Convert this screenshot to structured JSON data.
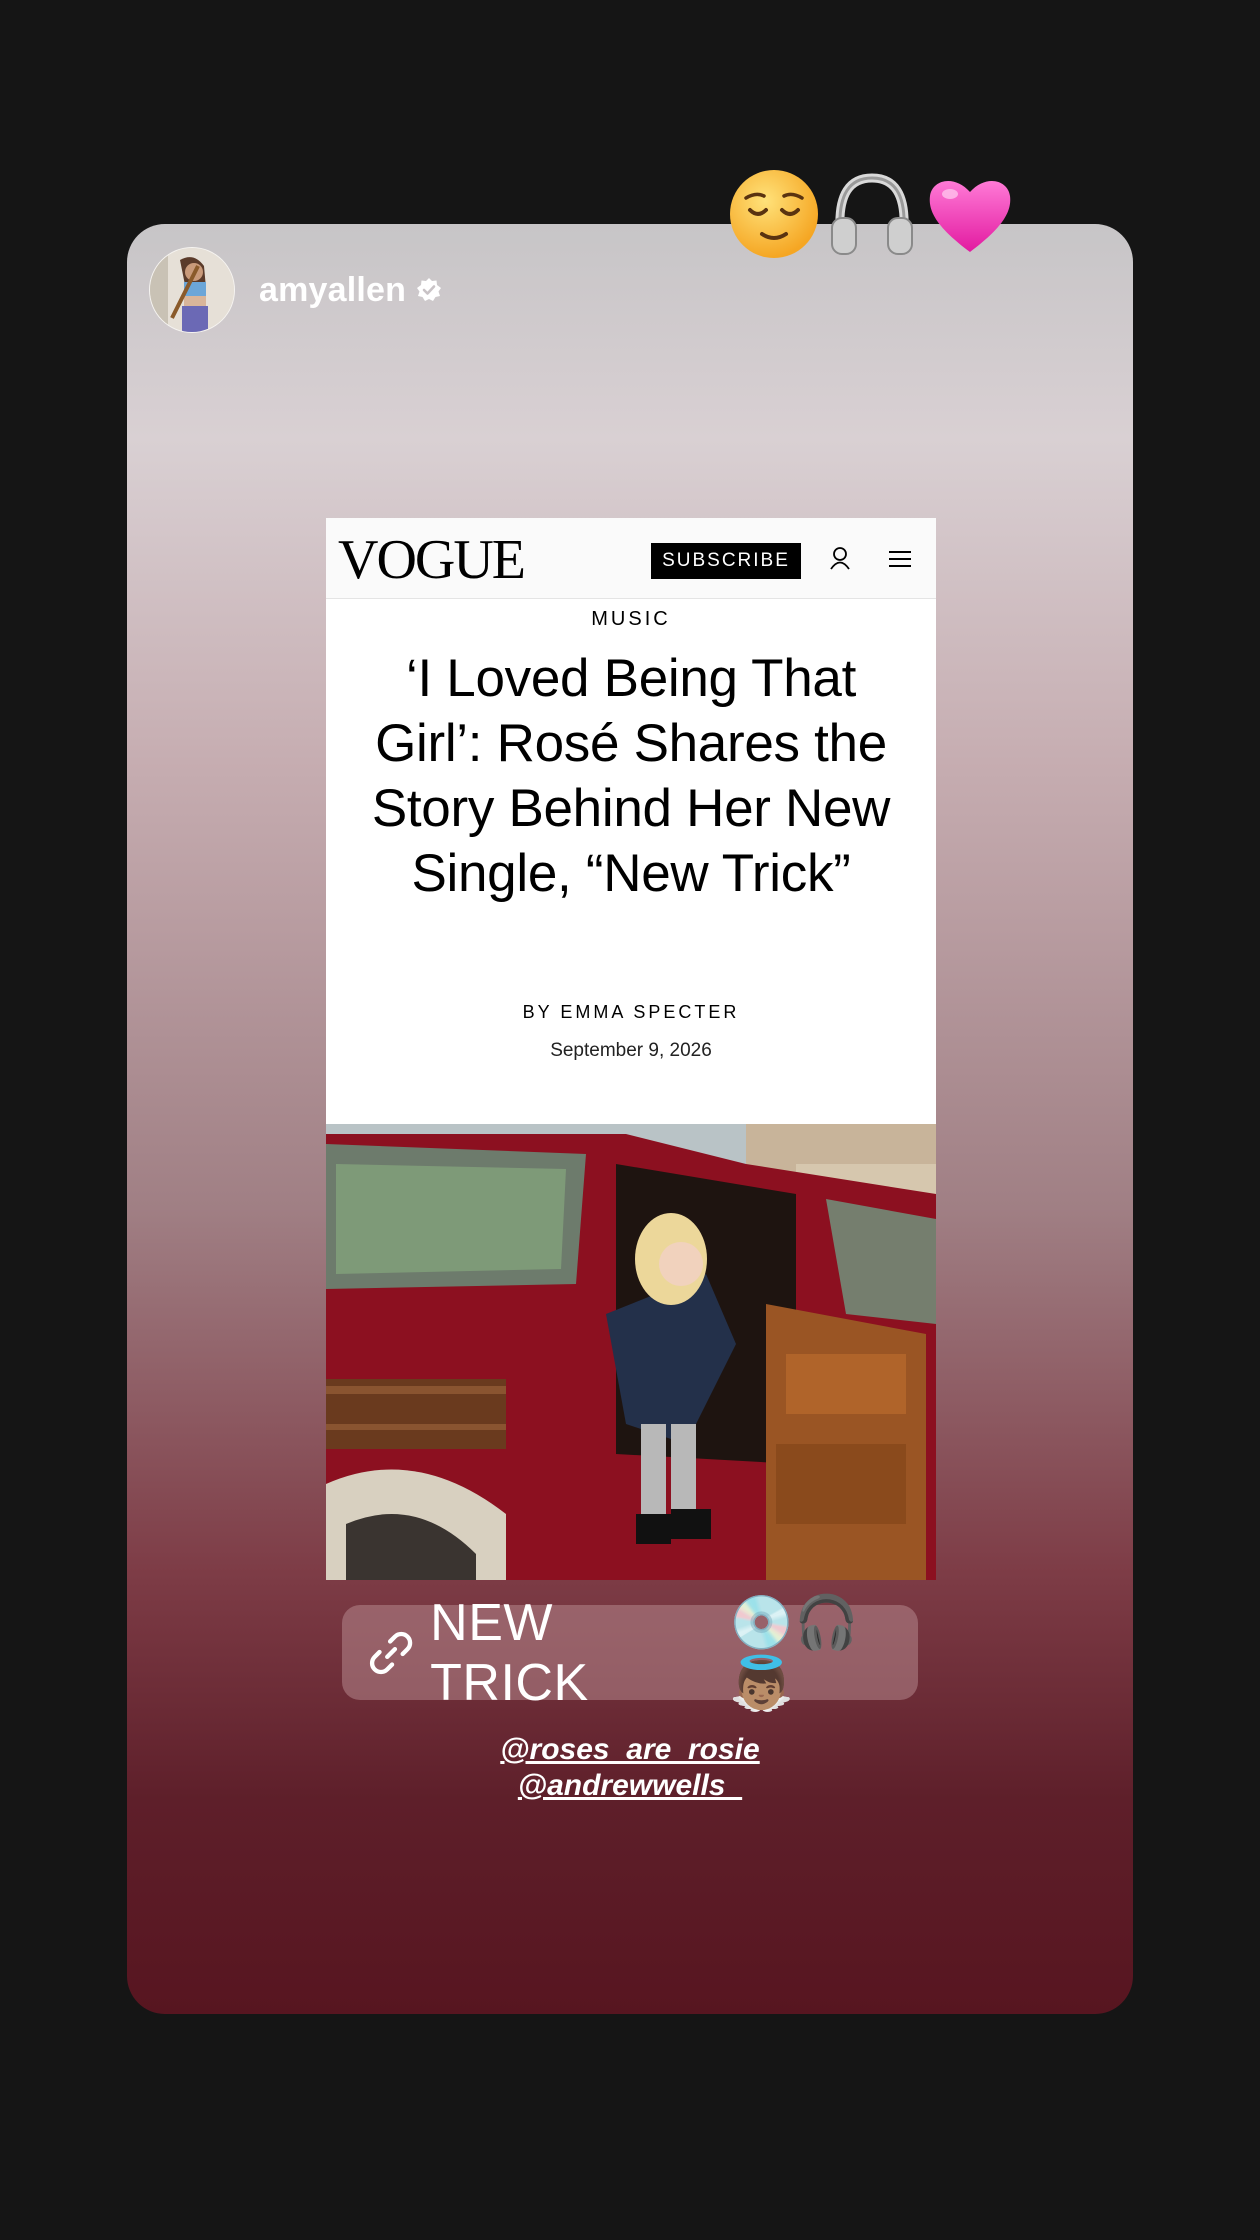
{
  "story": {
    "username": "amyallen",
    "verified": true,
    "emoji_sticker": [
      "😌",
      "🎧",
      "💗"
    ]
  },
  "article": {
    "publication": "VOGUE",
    "subscribe_label": "SUBSCRIBE",
    "section": "MUSIC",
    "headline": "‘I Loved Being That Girl’: Rosé Shares the Story Behind Her New Single, “New Trick”",
    "byline": "BY EMMA SPECTER",
    "date": "September 9, 2026"
  },
  "link_sticker": {
    "label": "NEW TRICK",
    "emojis": "💿🎧👼🏽"
  },
  "mentions": [
    "@roses_are_rosie",
    "@andrewwells_"
  ]
}
